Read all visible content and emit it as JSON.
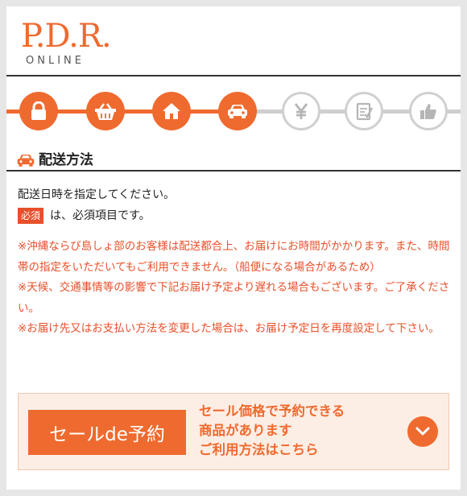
{
  "header": {
    "logo_main": "P.D.R.",
    "logo_sub": "ONLINE"
  },
  "steps": [
    {
      "icon": "lock-icon",
      "state": "active"
    },
    {
      "icon": "basket-icon",
      "state": "active"
    },
    {
      "icon": "house-icon",
      "state": "active"
    },
    {
      "icon": "car-icon",
      "state": "active"
    },
    {
      "icon": "yen-icon",
      "state": "inactive"
    },
    {
      "icon": "checklist-icon",
      "state": "inactive"
    },
    {
      "icon": "thumbs-up-icon",
      "state": "inactive"
    }
  ],
  "section": {
    "icon": "car-icon",
    "title": "配送方法"
  },
  "body": {
    "intro": "配送日時を指定してください。",
    "required_badge": "必須",
    "required_text": "は、必須項目です。",
    "notes": [
      "※沖縄ならび島しょ部のお客様は配送都合上、お届けにお時間がかかります。また、時間帯の指定をいただいてもご利用できません。（船便になる場合があるため）",
      "※天候、交通事情等の影響で下記お届け予定より遅れる場合もございます。ご了承ください。",
      "※お届け先又はお支払い方法を変更した場合は、お届け予定日を再度設定して下さい。"
    ]
  },
  "banner": {
    "button_label": "セールde予約",
    "text_lines": [
      "セール価格で予約できる",
      "商品があります",
      "ご利用方法はこちら"
    ]
  },
  "colors": {
    "accent": "#ef6a2e",
    "note_red": "#e8502a",
    "inactive_gray": "#d0d0d0",
    "banner_bg": "#fdeee5"
  }
}
